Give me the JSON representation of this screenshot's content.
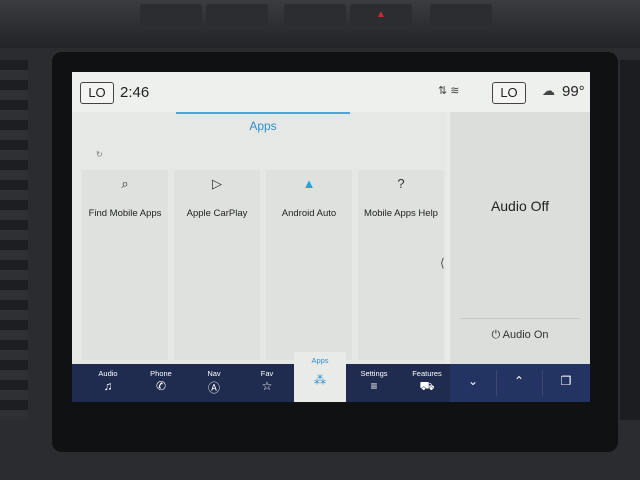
{
  "hardware": {
    "buttons": [
      "",
      "",
      "",
      "",
      ""
    ]
  },
  "status_bar": {
    "left_temp_label": "LO",
    "time": "2:46",
    "right_temp_label": "LO",
    "outside_temp": "99°",
    "signal_icon": "signal-icon",
    "weather_icon": "cloud-icon"
  },
  "apps_panel": {
    "title": "Apps",
    "tiles": [
      {
        "label": "Find Mobile Apps",
        "icon": "search-apps-icon",
        "glyph": "⌕"
      },
      {
        "label": "Apple CarPlay",
        "icon": "carplay-icon",
        "glyph": "▷"
      },
      {
        "label": "Android Auto",
        "icon": "android-auto-icon",
        "glyph": "▲"
      },
      {
        "label": "Mobile Apps Help",
        "icon": "help-icon",
        "glyph": "?"
      }
    ]
  },
  "audio_panel": {
    "status": "Audio Off",
    "on_button": "Audio On"
  },
  "nav_bar": {
    "items": [
      {
        "label": "Audio",
        "glyph": "♫"
      },
      {
        "label": "Phone",
        "glyph": "✆"
      },
      {
        "label": "Nav",
        "glyph": "Ⓐ"
      },
      {
        "label": "Fav",
        "glyph": "☆"
      },
      {
        "label": "Apps",
        "glyph": "⁂"
      },
      {
        "label": "Settings",
        "glyph": "≡"
      },
      {
        "label": "Features",
        "glyph": "⛟"
      },
      {
        "label": "",
        "glyph": "⌄"
      },
      {
        "label": "",
        "glyph": "⌃"
      },
      {
        "label": "",
        "glyph": "❐"
      }
    ],
    "active": "Apps"
  },
  "colors": {
    "accent": "#2f8fcf",
    "nav_bg": "#1f2c4f",
    "screen_bg": "#e9ebe8"
  }
}
